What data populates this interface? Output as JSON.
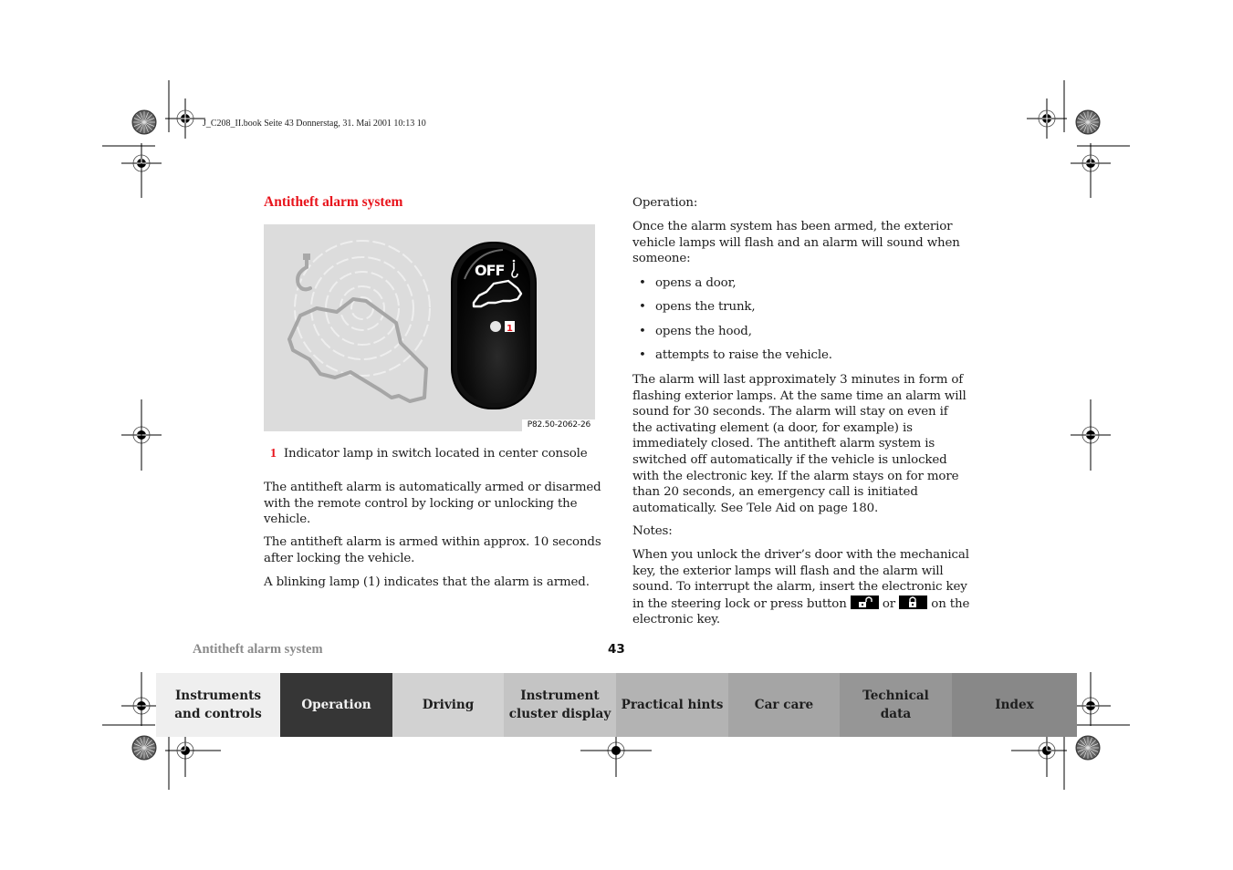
{
  "file_header": "J_C208_II.book  Seite 43  Donnerstag, 31. Mai 2001  10:13 10",
  "section_title": "Antitheft alarm system",
  "figure": {
    "code": "P82.50-2062-26",
    "switch_label": "OFF",
    "callout": "1"
  },
  "legend": {
    "number": "1",
    "text": "Indicator lamp in switch located in center console"
  },
  "left_paragraphs": [
    "The antitheft alarm is automatically armed or disarmed with the remote control by locking or unlocking the vehicle.",
    "The antitheft alarm is armed within approx. 10 seconds after locking the vehicle.",
    "A blinking lamp (1) indicates that the alarm is armed."
  ],
  "right": {
    "operation_heading": "Operation:",
    "intro": "Once the alarm system has been armed, the exterior vehicle lamps will flash and an alarm will sound when someone:",
    "bullets": [
      "opens a door,",
      "opens the trunk,",
      "opens the hood,",
      "attempts to raise the vehicle."
    ],
    "duration_paragraph": "The alarm will last approximately 3 minutes in form of flashing exterior lamps. At the same time an alarm will sound for 30 seconds. The alarm will stay on even if the activating element (a door, for example) is immediately closed. The antitheft alarm system is switched off automatically if the vehicle is unlocked with the electronic key. If the alarm stays on for more than 20 seconds, an emergency call is initiated automatically. See Tele Aid on page 180.",
    "notes_heading": "Notes:",
    "notes_part1": "When you unlock the driver’s door with the mechanical key, the exterior lamps will flash and the alarm will sound. To interrupt the alarm, insert the electronic key in the steering lock or press button",
    "notes_or": "or",
    "notes_part2": "on the electronic key.",
    "unlock_icon": "unlock-button-icon",
    "lock_icon": "lock-button-icon"
  },
  "footer": {
    "section_title": "Antitheft alarm system",
    "page_number": "43"
  },
  "tabs": [
    {
      "label": "Instruments\nand controls",
      "bg": "#efefef",
      "fg": "#1e1e1e",
      "active": false
    },
    {
      "label": "Operation",
      "bg": "#363636",
      "fg": "#f2f2f2",
      "active": true
    },
    {
      "label": "Driving",
      "bg": "#d2d2d2",
      "fg": "#1e1e1e",
      "active": false
    },
    {
      "label": "Instrument\ncluster display",
      "bg": "#c4c4c4",
      "fg": "#1e1e1e",
      "active": false
    },
    {
      "label": "Practical hints",
      "bg": "#b3b3b3",
      "fg": "#1e1e1e",
      "active": false
    },
    {
      "label": "Car care",
      "bg": "#a5a5a5",
      "fg": "#1e1e1e",
      "active": false
    },
    {
      "label": "Technical\ndata",
      "bg": "#969696",
      "fg": "#1e1e1e",
      "active": false
    },
    {
      "label": "Index",
      "bg": "#888888",
      "fg": "#1e1e1e",
      "active": false
    }
  ],
  "colors": {
    "accent_red": "#e8141c",
    "figure_bg": "#dcdcdc",
    "footer_title": "#8a8a8a"
  }
}
